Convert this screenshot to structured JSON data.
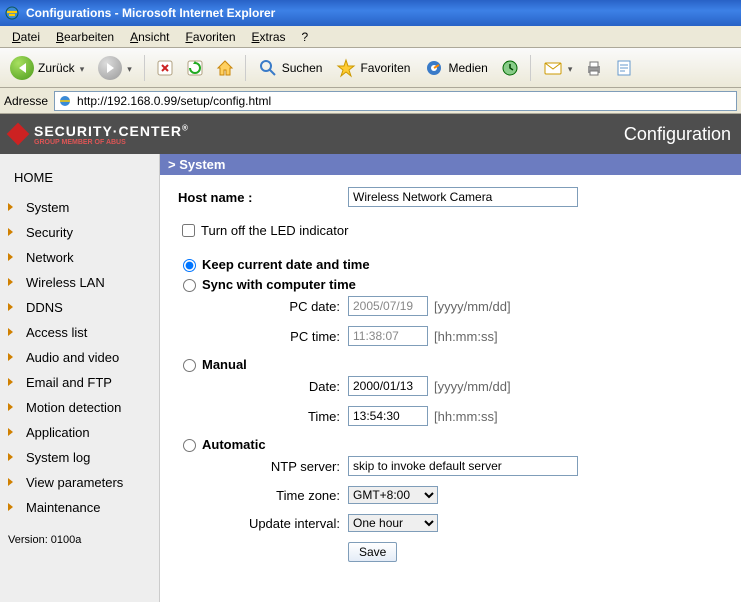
{
  "window": {
    "title": "Configurations - Microsoft Internet Explorer"
  },
  "menubar": {
    "file": "Datei",
    "edit": "Bearbeiten",
    "view": "Ansicht",
    "fav": "Favoriten",
    "extras": "Extras",
    "help": "?"
  },
  "toolbar": {
    "back": "Zurück",
    "search": "Suchen",
    "favorites": "Favoriten",
    "media": "Medien"
  },
  "addressbar": {
    "label": "Adresse",
    "url": "http://192.168.0.99/setup/config.html"
  },
  "header": {
    "brand": "SECURITY·CENTER",
    "brand_sub": "GROUP MEMBER OF ABUS",
    "title": "Configuration"
  },
  "sidebar": {
    "home": "HOME",
    "items": [
      "System",
      "Security",
      "Network",
      "Wireless LAN",
      "DDNS",
      "Access list",
      "Audio and video",
      "Email and FTP",
      "Motion detection",
      "Application",
      "System log",
      "View parameters",
      "Maintenance"
    ],
    "version": "Version: 0100a"
  },
  "section": {
    "title": "> System"
  },
  "form": {
    "hostname_label": "Host name :",
    "hostname_value": "Wireless Network Camera",
    "led_label": "Turn off the LED indicator",
    "dt_keep": "Keep current date and time",
    "dt_sync": "Sync with computer time",
    "pc_date_label": "PC date:",
    "pc_date_value": "2005/07/19",
    "pc_date_hint": "[yyyy/mm/dd]",
    "pc_time_label": "PC time:",
    "pc_time_value": "11:38:07",
    "pc_time_hint": "[hh:mm:ss]",
    "dt_manual": "Manual",
    "man_date_label": "Date:",
    "man_date_value": "2000/01/13",
    "man_date_hint": "[yyyy/mm/dd]",
    "man_time_label": "Time:",
    "man_time_value": "13:54:30",
    "man_time_hint": "[hh:mm:ss]",
    "dt_auto": "Automatic",
    "ntp_label": "NTP server:",
    "ntp_value": "skip to invoke default server",
    "tz_label": "Time zone:",
    "tz_value": "GMT+8:00",
    "interval_label": "Update interval:",
    "interval_value": "One hour",
    "save": "Save"
  }
}
